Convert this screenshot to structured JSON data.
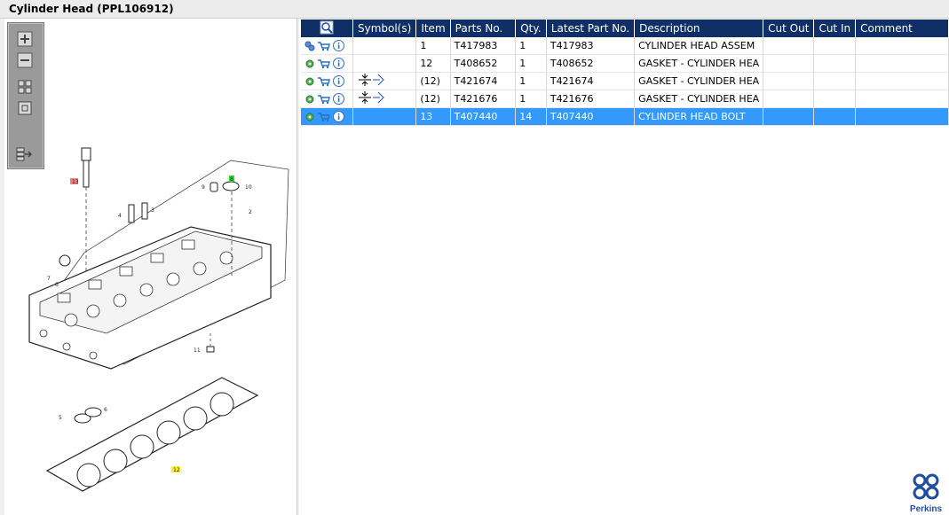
{
  "window": {
    "title": "Cylinder Head (PPL106912)"
  },
  "toolbar": {
    "buttons": [
      {
        "name": "zoom-in-button",
        "icon": "plus-icon"
      },
      {
        "name": "zoom-out-button",
        "icon": "minus-icon"
      },
      {
        "name": "fit-view-button",
        "icon": "fit-icon"
      },
      {
        "name": "actual-size-button",
        "icon": "square-icon"
      },
      {
        "name": "export-button",
        "icon": "arrow-right-icon"
      }
    ]
  },
  "diagram": {
    "callouts": [
      "13",
      "8",
      "9",
      "10",
      "4",
      "3",
      "2",
      "7",
      "6",
      "11",
      "5",
      "6",
      "12"
    ]
  },
  "table": {
    "columns": [
      "Symbol(s)",
      "Item",
      "Parts No.",
      "Qty.",
      "Latest Part No.",
      "Description",
      "Cut Out",
      "Cut In",
      "Comment"
    ],
    "rows": [
      {
        "item": "1",
        "part_no": "T417983",
        "qty": "1",
        "latest": "T417983",
        "desc": "CYLINDER HEAD ASSEM",
        "symbols": ""
      },
      {
        "item": "12",
        "part_no": "T408652",
        "qty": "1",
        "latest": "T408652",
        "desc": "GASKET - CYLINDER HEA",
        "symbols": ""
      },
      {
        "item": "(12)",
        "part_no": "T421674",
        "qty": "1",
        "latest": "T421674",
        "desc": "GASKET - CYLINDER HEA",
        "symbols": "replace-symbol"
      },
      {
        "item": "(12)",
        "part_no": "T421676",
        "qty": "1",
        "latest": "T421676",
        "desc": "GASKET - CYLINDER HEA",
        "symbols": "replace-symbol"
      },
      {
        "item": "13",
        "part_no": "T407440",
        "qty": "14",
        "latest": "T407440",
        "desc": "CYLINDER HEAD BOLT",
        "symbols": "",
        "selected": true
      }
    ]
  },
  "brand": {
    "name": "Perkins",
    "color": "#1f4e9e"
  },
  "colors": {
    "header": "#0f2f66",
    "selected": "#3399ff",
    "cart": "#2a6fc4",
    "gear": "#4caf50"
  }
}
